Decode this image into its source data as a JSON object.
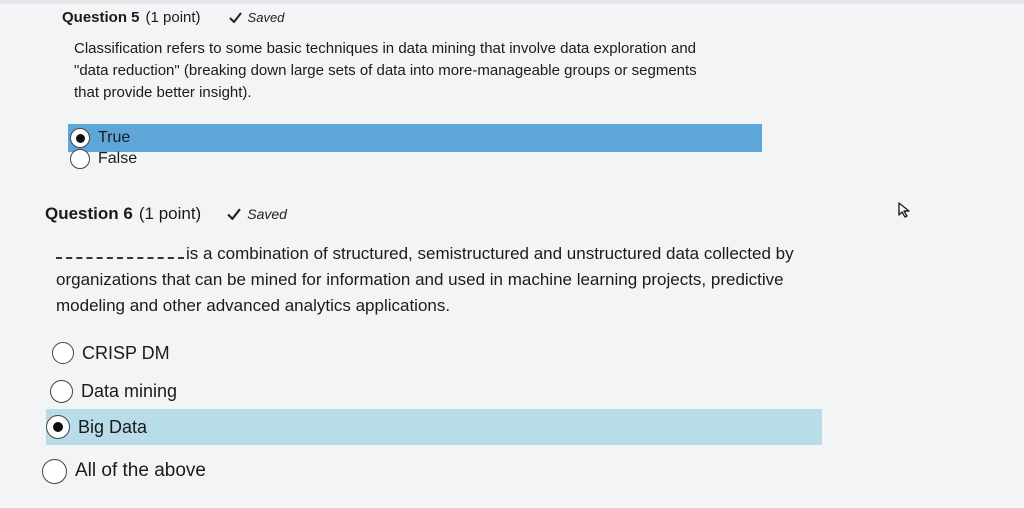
{
  "q5": {
    "title": "Question 5",
    "points": "(1 point)",
    "saved": "Saved",
    "text": "Classification refers to some basic techniques in data mining that involve data exploration and \"data reduction\" (breaking down large sets of data into more-manageable groups or segments that provide better insight).",
    "options": [
      {
        "label": "True",
        "selected": true
      },
      {
        "label": "False",
        "selected": false
      }
    ]
  },
  "q6": {
    "title": "Question 6",
    "points": "(1 point)",
    "saved": "Saved",
    "text": "is a combination of structured, semistructured and unstructured data collected by organizations that can be mined for information and used in machine learning projects, predictive modeling and other advanced analytics applications.",
    "options": [
      {
        "label": "CRISP DM",
        "selected": false
      },
      {
        "label": "Data mining",
        "selected": false
      },
      {
        "label": "Big Data",
        "selected": true
      },
      {
        "label": "All of the above",
        "selected": false
      }
    ]
  },
  "colors": {
    "selected_q5": "#5ea6d8",
    "selected_q6": "#b8dde8"
  },
  "icons": {
    "saved": "checkmark-icon",
    "cursor": "mouse-pointer-icon"
  }
}
